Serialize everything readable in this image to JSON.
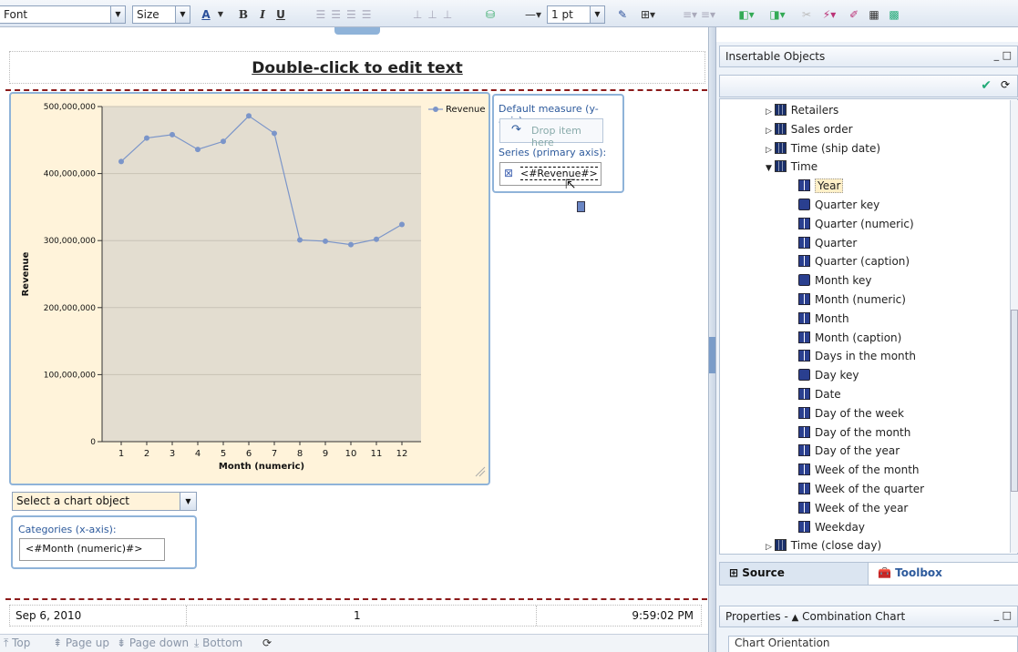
{
  "toolbar": {
    "font": "Font",
    "size": "Size",
    "line_width": "1 pt",
    "bold": "B",
    "italic": "I",
    "underline": "U"
  },
  "report": {
    "header_text": "Double-click to edit text",
    "footer_date": "Sep 6, 2010",
    "footer_page": "1",
    "footer_time": "9:59:02 PM"
  },
  "chart_data": {
    "type": "line",
    "x": [
      1,
      2,
      3,
      4,
      5,
      6,
      7,
      8,
      9,
      10,
      11,
      12
    ],
    "series": [
      {
        "name": "Revenue",
        "values": [
          418000000,
          453000000,
          458000000,
          436000000,
          448000000,
          486000000,
          460000000,
          301000000,
          299000000,
          294000000,
          302000000,
          324000000
        ]
      }
    ],
    "xlabel": "Month (numeric)",
    "ylabel": "Revenue",
    "ylim": [
      0,
      500000000
    ],
    "y_ticks": [
      "0",
      "100,000,000",
      "200,000,000",
      "300,000,000",
      "400,000,000",
      "500,000,000"
    ],
    "x_ticks": [
      "1",
      "2",
      "3",
      "4",
      "5",
      "6",
      "7",
      "8",
      "9",
      "10",
      "11",
      "12"
    ],
    "legend": "top-right",
    "grid": true,
    "colors": {
      "line": "#7b95c9",
      "plot_bg": "#e3ddd0",
      "frame_bg": "#fff3da"
    }
  },
  "chart_panels": {
    "default_measure_label": "Default measure (y-axis):",
    "drop_item": "Drop item here",
    "series_label": "Series (primary axis):",
    "series_value": "<#Revenue#>",
    "chart_object_select": "Select a chart object",
    "categories_label": "Categories (x-axis):",
    "categories_value": "<#Month (numeric)#>"
  },
  "pager": {
    "top": "Top",
    "page_up": "Page up",
    "page_down": "Page down",
    "bottom": "Bottom"
  },
  "insertable": {
    "title": "Insertable Objects",
    "items": [
      {
        "label": "Retailers",
        "type": "dim"
      },
      {
        "label": "Sales order",
        "type": "dim"
      },
      {
        "label": "Time (ship date)",
        "type": "dim"
      },
      {
        "label": "Time",
        "type": "dim"
      },
      {
        "label": "Year",
        "type": "level"
      },
      {
        "label": "Quarter key",
        "type": "key"
      },
      {
        "label": "Quarter (numeric)",
        "type": "level"
      },
      {
        "label": "Quarter",
        "type": "level"
      },
      {
        "label": "Quarter (caption)",
        "type": "level"
      },
      {
        "label": "Month key",
        "type": "key"
      },
      {
        "label": "Month (numeric)",
        "type": "level"
      },
      {
        "label": "Month",
        "type": "level"
      },
      {
        "label": "Month (caption)",
        "type": "level"
      },
      {
        "label": "Days in the month",
        "type": "level"
      },
      {
        "label": "Day key",
        "type": "key"
      },
      {
        "label": "Date",
        "type": "level"
      },
      {
        "label": "Day of the week",
        "type": "level"
      },
      {
        "label": "Day of the month",
        "type": "level"
      },
      {
        "label": "Day of the year",
        "type": "level"
      },
      {
        "label": "Week of the month",
        "type": "level"
      },
      {
        "label": "Week of the quarter",
        "type": "level"
      },
      {
        "label": "Week of the year",
        "type": "level"
      },
      {
        "label": "Weekday",
        "type": "level"
      },
      {
        "label": "Time (close day)",
        "type": "dim"
      }
    ],
    "tabs": {
      "source": "Source",
      "toolbox": "Toolbox"
    }
  },
  "properties": {
    "title": "Properties -",
    "object": "Combination Chart",
    "section": "Chart Orientation"
  }
}
